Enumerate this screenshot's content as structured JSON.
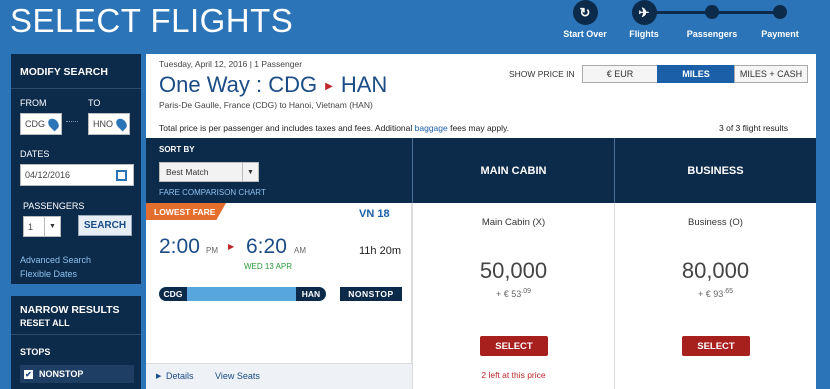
{
  "header": {
    "title": "SELECT FLIGHTS"
  },
  "steps": [
    {
      "label": "Start Over",
      "icon": "refresh-icon"
    },
    {
      "label": "Flights",
      "icon": "plane-icon"
    },
    {
      "label": "Passengers"
    },
    {
      "label": "Payment"
    }
  ],
  "sidebar": {
    "title": "MODIFY SEARCH",
    "from_label": "FROM",
    "from_value": "CDG",
    "to_label": "TO",
    "to_value": "HNO",
    "dates_label": "DATES",
    "date_value": "04/12/2016",
    "passengers_label": "PASSENGERS",
    "passengers_value": "1",
    "search_button": "SEARCH",
    "advanced_search": "Advanced Search",
    "flexible_dates": "Flexible Dates"
  },
  "narrow": {
    "title": "NARROW RESULTS",
    "reset": "RESET ALL",
    "stops_label": "STOPS",
    "stop_option": "NONSTOP",
    "stop_checked": true
  },
  "summary": {
    "date_line": "Tuesday, April 12, 2016 | 1 Passenger",
    "trip_type": "One Way :",
    "origin": "CDG",
    "destination": "HAN",
    "route_detail": "Paris-De Gaulle, France (CDG) to Hanoi, Vietnam (HAN)",
    "price_note_pre": "Total price is per passenger and includes taxes and fees. Additional ",
    "price_note_link": "baggage",
    "price_note_post": " fees may apply.",
    "results_count": "3 of 3 flight results"
  },
  "price_toggle": {
    "label": "SHOW PRICE IN",
    "options": [
      "€ EUR",
      "MILES",
      "MILES + CASH"
    ],
    "selected": "MILES"
  },
  "sort": {
    "label": "SORT BY",
    "value": "Best Match",
    "fare_chart_link": "FARE COMPARISON CHART"
  },
  "columns": {
    "main": "MAIN CABIN",
    "business": "BUSINESS"
  },
  "flight": {
    "badge": "LOWEST FARE",
    "flight_number": "VN 18",
    "depart_time": "2:00",
    "depart_ampm": "PM",
    "arrive_time": "6:20",
    "arrive_ampm": "AM",
    "arrive_date": "WED 13 APR",
    "duration": "11h 20m",
    "from": "CDG",
    "to": "HAN",
    "stops": "NONSTOP",
    "details_link": "Details",
    "seats_link": "View Seats"
  },
  "fares": [
    {
      "cabin": "Main Cabin (X)",
      "miles": "50,000",
      "tax_prefix": "+ €",
      "tax_int": "53",
      "tax_dec": ".09",
      "button": "SELECT",
      "note": "2 left at this price"
    },
    {
      "cabin": "Business (O)",
      "miles": "80,000",
      "tax_prefix": "+ €",
      "tax_int": "93",
      "tax_dec": ".65",
      "button": "SELECT",
      "note": ""
    }
  ],
  "colors": {
    "brand_blue": "#2b74b8",
    "navy": "#0c2a4a",
    "select_red": "#a8201e",
    "badge_orange": "#e46e2d",
    "link_light": "#8ec1ee"
  }
}
